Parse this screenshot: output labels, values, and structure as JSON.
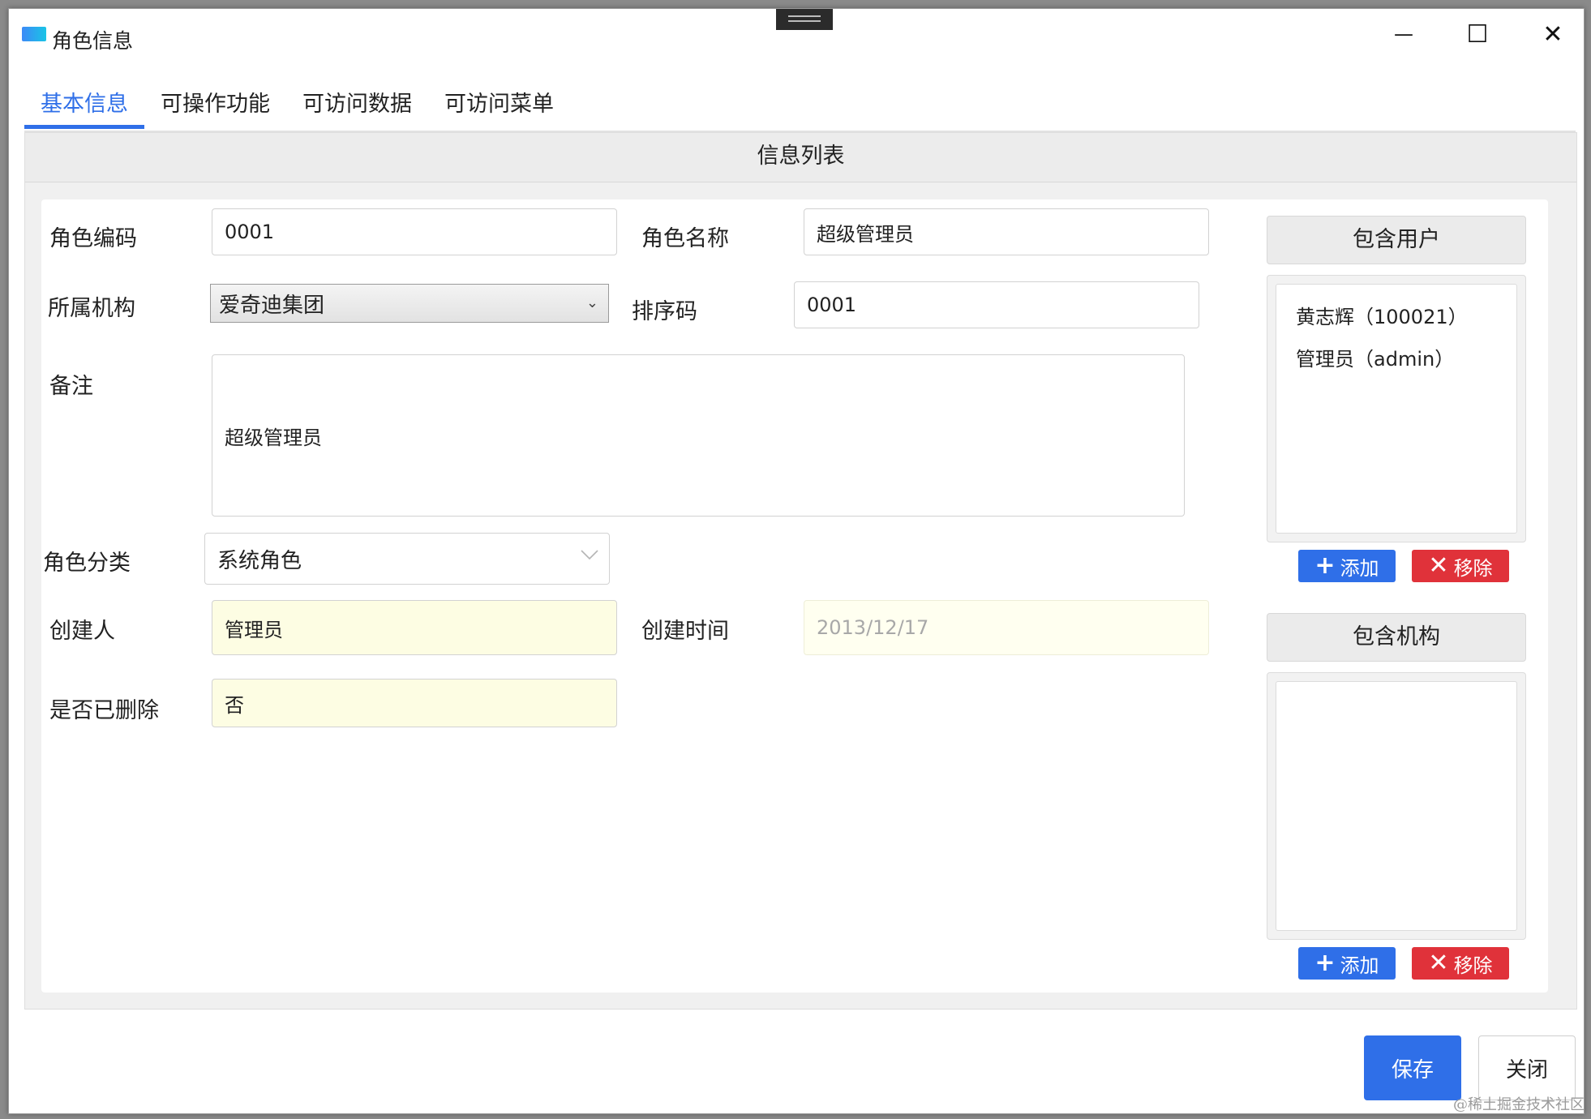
{
  "window": {
    "title": "角色信息",
    "minimize_glyph": "—",
    "maximize_glyph": "☐",
    "close_glyph": "✕"
  },
  "tabs": [
    {
      "label": "基本信息",
      "active": true
    },
    {
      "label": "可操作功能",
      "active": false
    },
    {
      "label": "可访问数据",
      "active": false
    },
    {
      "label": "可访问菜单",
      "active": false
    }
  ],
  "panel": {
    "header": "信息列表"
  },
  "form": {
    "role_code": {
      "label": "角色编码",
      "value": "0001"
    },
    "role_name": {
      "label": "角色名称",
      "value": "超级管理员"
    },
    "org": {
      "label": "所属机构",
      "value": "爱奇迪集团"
    },
    "sort_code": {
      "label": "排序码",
      "value": "0001"
    },
    "remark": {
      "label": "备注",
      "value": "超级管理员"
    },
    "role_category": {
      "label": "角色分类",
      "value": "系统角色"
    },
    "creator": {
      "label": "创建人",
      "value": "管理员"
    },
    "created_time": {
      "label": "创建时间",
      "value": "2013/12/17"
    },
    "deleted": {
      "label": "是否已删除",
      "value": "否"
    }
  },
  "users_panel": {
    "header": "包含用户",
    "items": [
      "黄志辉（100021）",
      "管理员（admin）"
    ],
    "add_label": "添加",
    "remove_label": "移除"
  },
  "orgs_panel": {
    "header": "包含机构",
    "items": [],
    "add_label": "添加",
    "remove_label": "移除"
  },
  "footer": {
    "save_label": "保存",
    "close_label": "关闭"
  },
  "watermark": "@稀土掘金技术社区",
  "colors": {
    "accent": "#2f6fe8",
    "danger": "#e0323a",
    "readonly_bg": "#fdfde3"
  }
}
